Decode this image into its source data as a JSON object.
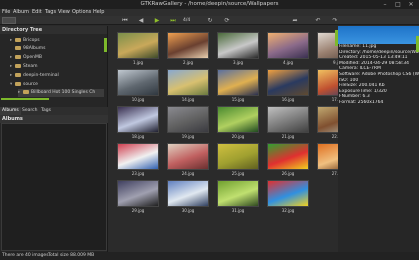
{
  "window": {
    "title": "GTKRawGallery - /home/deepin/source/Wallpapers",
    "controls": [
      "–",
      "□",
      "✕"
    ]
  },
  "menu": [
    "File",
    "Album",
    "Edit",
    "Tags",
    "View",
    "Options",
    "Help"
  ],
  "toolbar": {
    "page": "4/4",
    "icons": [
      "prev-icon",
      "next-icon",
      "first-icon",
      "last-icon",
      "refresh-icon",
      "rotate-icon",
      "forward-icon",
      "undo-icon",
      "redo-icon"
    ]
  },
  "left_pane": {
    "directory_header": "Directory Tree",
    "tree": [
      {
        "label": "Bricops",
        "level": 1,
        "expanded": false
      },
      {
        "label": "98Albums",
        "level": 1,
        "expanded": false
      },
      {
        "label": "OpenMB",
        "level": 1,
        "expanded": false
      },
      {
        "label": "Steam",
        "level": 1,
        "expanded": false
      },
      {
        "label": "deepin-terminal",
        "level": 1,
        "expanded": false
      },
      {
        "label": "source",
        "level": 1,
        "expanded": true
      },
      {
        "label": "Billboard Hot 100 Singles Ch",
        "level": 2,
        "expanded": false
      }
    ],
    "tabs": [
      "Albums",
      "Search",
      "Tags"
    ],
    "albums_header": "Albums"
  },
  "thumbnails": [
    {
      "caption": "1.jpg",
      "colors": [
        "#7a8f4a",
        "#c9a85a",
        "#3d4a2a"
      ]
    },
    {
      "caption": "2.jpg",
      "colors": [
        "#f0a050",
        "#6a4030",
        "#e8d0b0"
      ]
    },
    {
      "caption": "3.jpg",
      "colors": [
        "#4a6a3a",
        "#c8c8c8",
        "#2a2a2a"
      ]
    },
    {
      "caption": "4.jpg",
      "colors": [
        "#f0b070",
        "#8a6a8a",
        "#3a3050"
      ]
    },
    {
      "caption": "9.jpg",
      "colors": [
        "#e0d8d0",
        "#9a8070",
        "#5a4a40"
      ]
    },
    {
      "caption": "10.jpg",
      "colors": [
        "#c0c8d0",
        "#606870",
        "#303840"
      ]
    },
    {
      "caption": "14.jpg",
      "colors": [
        "#88a8d0",
        "#d8c070",
        "#6a7a40"
      ]
    },
    {
      "caption": "15.jpg",
      "colors": [
        "#5a70a0",
        "#e0b050",
        "#2a3050"
      ]
    },
    {
      "caption": "16.jpg",
      "colors": [
        "#f0a040",
        "#2a3a60",
        "#604a30"
      ]
    },
    {
      "caption": "17.jpg",
      "colors": [
        "#f0c060",
        "#c05030",
        "#2a4070"
      ]
    },
    {
      "caption": "18.jpg",
      "colors": [
        "#3a3050",
        "#c0c8e0",
        "#202030"
      ]
    },
    {
      "caption": "19.jpg",
      "colors": [
        "#8a8a90",
        "#606060",
        "#3a3a40"
      ]
    },
    {
      "caption": "20.jpg",
      "colors": [
        "#4a8a30",
        "#b0d060",
        "#204a20"
      ]
    },
    {
      "caption": "21.jpg",
      "colors": [
        "#c0c0c0",
        "#7a7a7a",
        "#404040"
      ]
    },
    {
      "caption": "22.jpg",
      "colors": [
        "#c0a870",
        "#805030",
        "#b0b0a0"
      ]
    },
    {
      "caption": "23.jpg",
      "colors": [
        "#d04050",
        "#f0f0f0",
        "#3060b0"
      ]
    },
    {
      "caption": "24.jpg",
      "colors": [
        "#e0d0c0",
        "#c06060",
        "#6a3030"
      ]
    },
    {
      "caption": "25.jpg",
      "colors": [
        "#d0c040",
        "#a0a030",
        "#606020"
      ]
    },
    {
      "caption": "26.jpg",
      "colors": [
        "#30a030",
        "#e03030",
        "#f0d020"
      ]
    },
    {
      "caption": "27.jpg",
      "colors": [
        "#e07020",
        "#f0c080",
        "#603010"
      ]
    },
    {
      "caption": "29.jpg",
      "colors": [
        "#404060",
        "#a0a0b0",
        "#202020"
      ]
    },
    {
      "caption": "30.jpg",
      "colors": [
        "#6080c0",
        "#e0e8f0",
        "#304060"
      ]
    },
    {
      "caption": "31.jpg",
      "colors": [
        "#70a030",
        "#c0e070",
        "#304a20"
      ]
    },
    {
      "caption": "32.jpg",
      "colors": [
        "#e03030",
        "#3090e0",
        "#f0d020"
      ]
    }
  ],
  "info": {
    "lines": [
      "Filename: 11.jpg",
      "Directory: /home/deepin/source/Wallpa",
      "Created: 2015-05-13 13:49:11",
      "Modified: 2014-04-29 08:58:34",
      "Camera: ILCE-7RM",
      "Software: Adobe Photoshop CS6 (Windo",
      "ISO: 100",
      "FileSize: 200.041 Kb",
      "ExposureTime: 1/320",
      "FNumber: 6.3",
      "Format: 2560x1764"
    ]
  },
  "status": {
    "images": "There are 40 images",
    "size": "Total size 88.009 MB"
  }
}
